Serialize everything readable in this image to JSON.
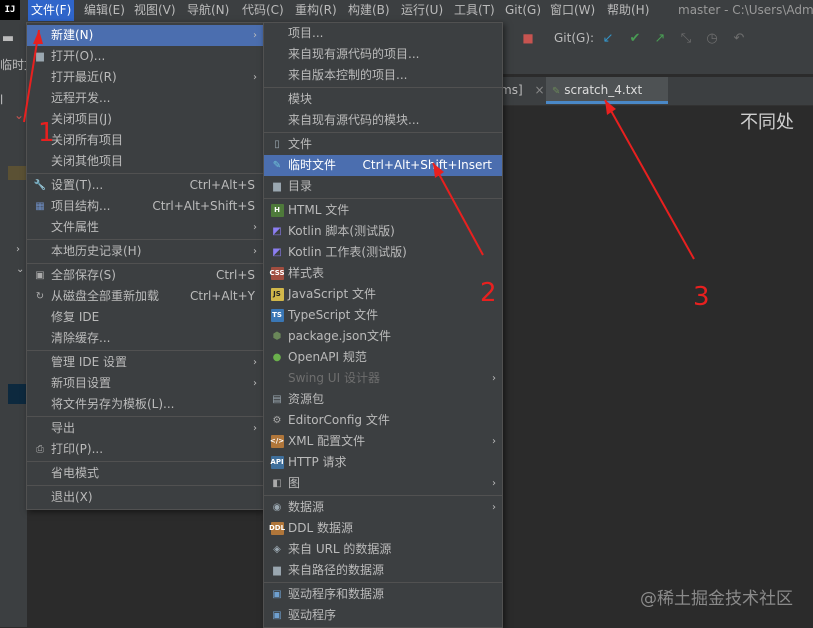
{
  "menubar": {
    "logo": "IJ",
    "items": [
      "文件(F)",
      "编辑(E)",
      "视图(V)",
      "导航(N)",
      "代码(C)",
      "重构(R)",
      "构建(B)",
      "运行(U)",
      "工具(T)",
      "Git(G)",
      "窗口(W)",
      "帮助(H)"
    ],
    "title": "master - C:\\Users\\Adm"
  },
  "toolbar": {
    "git_label": "Git(G):"
  },
  "navbar": {
    "temp_label": "临时文"
  },
  "tabs": [
    {
      "label": "ms]"
    },
    {
      "label": "scratch_4.txt"
    }
  ],
  "editor": {
    "text": "不同处"
  },
  "file_menu": {
    "items": [
      {
        "label": "新建(N)",
        "icon": "",
        "shortcut": "",
        "submenu": true
      },
      {
        "label": "打开(O)...",
        "icon": "folder-icon",
        "shortcut": "",
        "submenu": false
      },
      {
        "label": "打开最近(R)",
        "icon": "",
        "shortcut": "",
        "submenu": true
      },
      {
        "label": "远程开发...",
        "icon": "",
        "shortcut": "",
        "submenu": false
      },
      {
        "label": "关闭项目(J)",
        "icon": "",
        "shortcut": "",
        "submenu": false
      },
      {
        "label": "关闭所有项目",
        "icon": "",
        "shortcut": "",
        "submenu": false
      },
      {
        "label": "关闭其他项目",
        "icon": "",
        "shortcut": "",
        "submenu": false
      },
      {
        "label": "设置(T)...",
        "icon": "wrench-icon",
        "shortcut": "Ctrl+Alt+S",
        "submenu": false
      },
      {
        "label": "项目结构...",
        "icon": "project-structure-icon",
        "shortcut": "Ctrl+Alt+Shift+S",
        "submenu": false
      },
      {
        "label": "文件属性",
        "icon": "",
        "shortcut": "",
        "submenu": true
      },
      {
        "label": "本地历史记录(H)",
        "icon": "",
        "shortcut": "",
        "submenu": true
      },
      {
        "label": "全部保存(S)",
        "icon": "save-icon",
        "shortcut": "Ctrl+S",
        "submenu": false
      },
      {
        "label": "从磁盘全部重新加载",
        "icon": "reload-icon",
        "shortcut": "Ctrl+Alt+Y",
        "submenu": false
      },
      {
        "label": "修复 IDE",
        "icon": "",
        "shortcut": "",
        "submenu": false
      },
      {
        "label": "清除缓存...",
        "icon": "",
        "shortcut": "",
        "submenu": false
      },
      {
        "label": "管理 IDE 设置",
        "icon": "",
        "shortcut": "",
        "submenu": true
      },
      {
        "label": "新项目设置",
        "icon": "",
        "shortcut": "",
        "submenu": true
      },
      {
        "label": "将文件另存为模板(L)...",
        "icon": "",
        "shortcut": "",
        "submenu": false
      },
      {
        "label": "导出",
        "icon": "",
        "shortcut": "",
        "submenu": true
      },
      {
        "label": "打印(P)...",
        "icon": "print-icon",
        "shortcut": "",
        "submenu": false
      },
      {
        "label": "省电模式",
        "icon": "",
        "shortcut": "",
        "submenu": false
      },
      {
        "label": "退出(X)",
        "icon": "",
        "shortcut": "",
        "submenu": false
      }
    ]
  },
  "new_menu": {
    "items": [
      {
        "label": "项目...",
        "icon": "",
        "shortcut": "",
        "submenu": false,
        "disabled": false
      },
      {
        "label": "来自现有源代码的项目...",
        "icon": "",
        "shortcut": "",
        "submenu": false,
        "disabled": false
      },
      {
        "label": "来自版本控制的项目...",
        "icon": "",
        "shortcut": "",
        "submenu": false,
        "disabled": false
      },
      {
        "label": "模块",
        "icon": "",
        "shortcut": "",
        "submenu": false,
        "disabled": false
      },
      {
        "label": "来自现有源代码的模块...",
        "icon": "",
        "shortcut": "",
        "submenu": false,
        "disabled": false
      },
      {
        "label": "文件",
        "icon": "file-icon",
        "shortcut": "",
        "submenu": false,
        "disabled": false
      },
      {
        "label": "临时文件",
        "icon": "scratch-file-icon",
        "shortcut": "Ctrl+Alt+Shift+Insert",
        "submenu": false,
        "disabled": false
      },
      {
        "label": "目录",
        "icon": "folder-icon",
        "shortcut": "",
        "submenu": false,
        "disabled": false
      },
      {
        "label": "HTML 文件",
        "icon": "html-icon",
        "shortcut": "",
        "submenu": false,
        "disabled": false
      },
      {
        "label": "Kotlin 脚本(测试版)",
        "icon": "kotlin-icon",
        "shortcut": "",
        "submenu": false,
        "disabled": false
      },
      {
        "label": "Kotlin 工作表(测试版)",
        "icon": "kotlin-icon",
        "shortcut": "",
        "submenu": false,
        "disabled": false
      },
      {
        "label": "样式表",
        "icon": "css-icon",
        "shortcut": "",
        "submenu": false,
        "disabled": false
      },
      {
        "label": "JavaScript 文件",
        "icon": "javascript-icon",
        "shortcut": "",
        "submenu": false,
        "disabled": false
      },
      {
        "label": "TypeScript 文件",
        "icon": "typescript-icon",
        "shortcut": "",
        "submenu": false,
        "disabled": false
      },
      {
        "label": "package.json文件",
        "icon": "npm-icon",
        "shortcut": "",
        "submenu": false,
        "disabled": false
      },
      {
        "label": "OpenAPI 规范",
        "icon": "openapi-icon",
        "shortcut": "",
        "submenu": false,
        "disabled": false
      },
      {
        "label": "Swing UI 设计器",
        "icon": "",
        "shortcut": "",
        "submenu": true,
        "disabled": true
      },
      {
        "label": "资源包",
        "icon": "resource-bundle-icon",
        "shortcut": "",
        "submenu": false,
        "disabled": false
      },
      {
        "label": "EditorConfig 文件",
        "icon": "editorconfig-icon",
        "shortcut": "",
        "submenu": false,
        "disabled": false
      },
      {
        "label": "XML 配置文件",
        "icon": "xml-icon",
        "shortcut": "",
        "submenu": true,
        "disabled": false
      },
      {
        "label": "HTTP 请求",
        "icon": "http-api-icon",
        "shortcut": "",
        "submenu": false,
        "disabled": false
      },
      {
        "label": "图",
        "icon": "diagram-icon",
        "shortcut": "",
        "submenu": true,
        "disabled": false
      },
      {
        "label": "数据源",
        "icon": "database-icon",
        "shortcut": "",
        "submenu": true,
        "disabled": false
      },
      {
        "label": "DDL 数据源",
        "icon": "ddl-icon",
        "shortcut": "",
        "submenu": false,
        "disabled": false
      },
      {
        "label": "来自 URL 的数据源",
        "icon": "url-datasource-icon",
        "shortcut": "",
        "submenu": false,
        "disabled": false
      },
      {
        "label": "来自路径的数据源",
        "icon": "path-datasource-icon",
        "shortcut": "",
        "submenu": false,
        "disabled": false
      },
      {
        "label": "驱动程序和数据源",
        "icon": "driver-datasource-icon",
        "shortcut": "",
        "submenu": false,
        "disabled": false
      },
      {
        "label": "驱动程序",
        "icon": "driver-icon",
        "shortcut": "",
        "submenu": false,
        "disabled": false
      }
    ]
  },
  "annotations": [
    "1",
    "2",
    "3"
  ],
  "watermark": "@稀土掘金技术社区",
  "colors": {
    "menu_bg": "#3c3f41",
    "highlight": "#4b6eaf",
    "menubar_active": "#2f65ca",
    "annotation": "#e8201f"
  }
}
